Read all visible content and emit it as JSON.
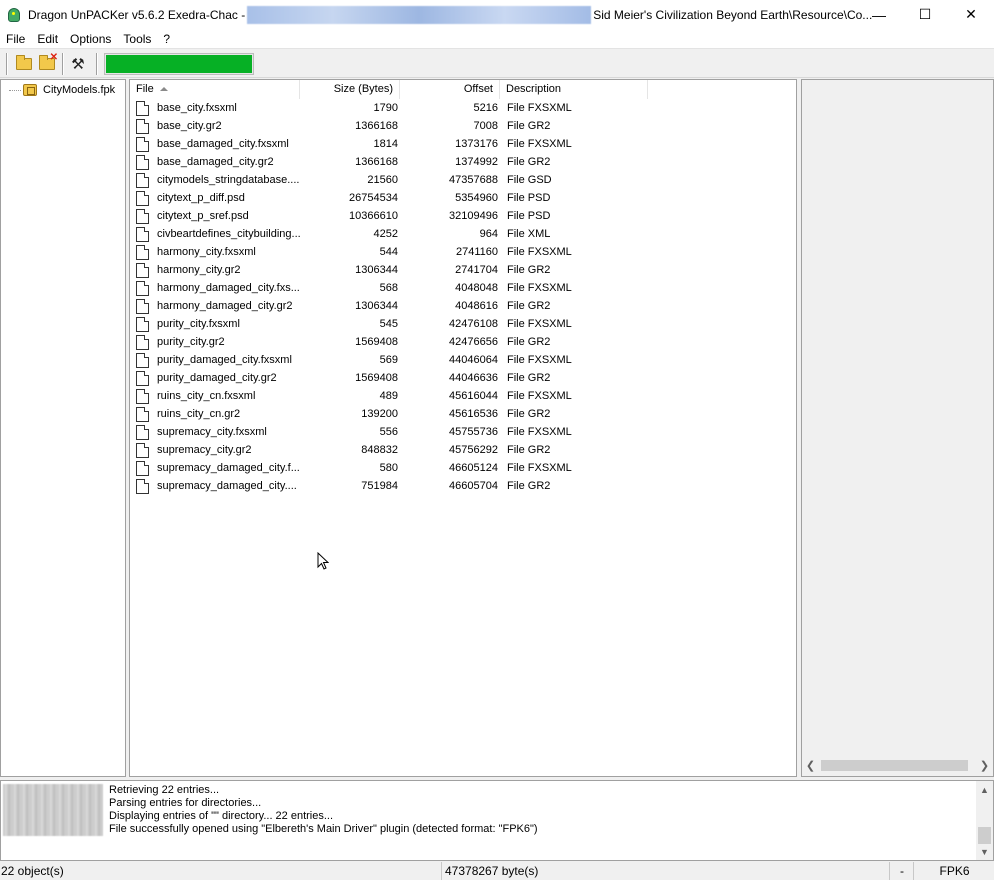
{
  "window": {
    "title_prefix": "Dragon UnPACKer v5.6.2 Exedra-Chac - ",
    "title_suffix": "Sid Meier's Civilization Beyond Earth\\Resource\\Co...",
    "minimize": "—",
    "maximize": "☐",
    "close": "✕"
  },
  "menu": {
    "file": "File",
    "edit": "Edit",
    "options": "Options",
    "tools": "Tools",
    "help": "?"
  },
  "toolbar": {
    "open_icon": "folder-open-icon",
    "close_icon": "folder-close-icon",
    "tools_icon": "tools-icon",
    "progress": 1.0,
    "progress_color": "#06b025"
  },
  "tree": {
    "root_label": "CityModels.fpk"
  },
  "list": {
    "columns": {
      "file": "File",
      "size": "Size (Bytes)",
      "offset": "Offset",
      "description": "Description"
    },
    "rows": [
      {
        "file": "base_city.fxsxml",
        "size": "1790",
        "offset": "5216",
        "desc": "File FXSXML"
      },
      {
        "file": "base_city.gr2",
        "size": "1366168",
        "offset": "7008",
        "desc": "File GR2"
      },
      {
        "file": "base_damaged_city.fxsxml",
        "size": "1814",
        "offset": "1373176",
        "desc": "File FXSXML"
      },
      {
        "file": "base_damaged_city.gr2",
        "size": "1366168",
        "offset": "1374992",
        "desc": "File GR2"
      },
      {
        "file": "citymodels_stringdatabase....",
        "size": "21560",
        "offset": "47357688",
        "desc": "File GSD"
      },
      {
        "file": "citytext_p_diff.psd",
        "size": "26754534",
        "offset": "5354960",
        "desc": "File PSD"
      },
      {
        "file": "citytext_p_sref.psd",
        "size": "10366610",
        "offset": "32109496",
        "desc": "File PSD"
      },
      {
        "file": "civbeartdefines_citybuilding...",
        "size": "4252",
        "offset": "964",
        "desc": "File XML"
      },
      {
        "file": "harmony_city.fxsxml",
        "size": "544",
        "offset": "2741160",
        "desc": "File FXSXML"
      },
      {
        "file": "harmony_city.gr2",
        "size": "1306344",
        "offset": "2741704",
        "desc": "File GR2"
      },
      {
        "file": "harmony_damaged_city.fxs...",
        "size": "568",
        "offset": "4048048",
        "desc": "File FXSXML"
      },
      {
        "file": "harmony_damaged_city.gr2",
        "size": "1306344",
        "offset": "4048616",
        "desc": "File GR2"
      },
      {
        "file": "purity_city.fxsxml",
        "size": "545",
        "offset": "42476108",
        "desc": "File FXSXML"
      },
      {
        "file": "purity_city.gr2",
        "size": "1569408",
        "offset": "42476656",
        "desc": "File GR2"
      },
      {
        "file": "purity_damaged_city.fxsxml",
        "size": "569",
        "offset": "44046064",
        "desc": "File FXSXML"
      },
      {
        "file": "purity_damaged_city.gr2",
        "size": "1569408",
        "offset": "44046636",
        "desc": "File GR2"
      },
      {
        "file": "ruins_city_cn.fxsxml",
        "size": "489",
        "offset": "45616044",
        "desc": "File FXSXML"
      },
      {
        "file": "ruins_city_cn.gr2",
        "size": "139200",
        "offset": "45616536",
        "desc": "File GR2"
      },
      {
        "file": "supremacy_city.fxsxml",
        "size": "556",
        "offset": "45755736",
        "desc": "File FXSXML"
      },
      {
        "file": "supremacy_city.gr2",
        "size": "848832",
        "offset": "45756292",
        "desc": "File GR2"
      },
      {
        "file": "supremacy_damaged_city.f...",
        "size": "580",
        "offset": "46605124",
        "desc": "File FXSXML"
      },
      {
        "file": "supremacy_damaged_city....",
        "size": "751984",
        "offset": "46605704",
        "desc": "File GR2"
      }
    ]
  },
  "log": {
    "lines": [
      "Retrieving 22 entries...",
      "Parsing entries for directories...",
      "Displaying entries of \"\" directory... 22 entries...",
      "File successfully opened using \"Elbereth's Main Driver\" plugin (detected format: \"FPK6\")"
    ]
  },
  "status": {
    "objects": "22 object(s)",
    "bytes": "47378267 byte(s)",
    "dash": "-",
    "format": "FPK6"
  }
}
